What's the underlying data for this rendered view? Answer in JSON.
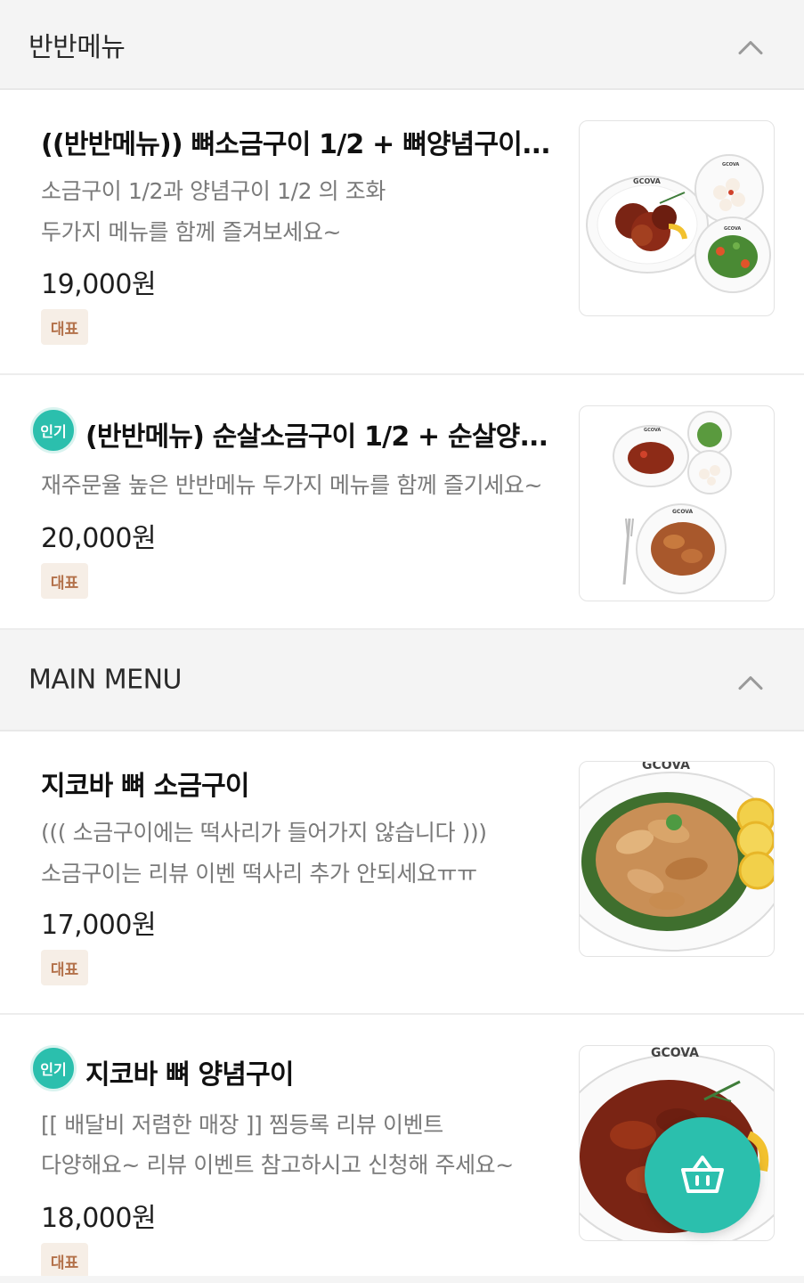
{
  "sections": [
    {
      "title": "반반메뉴",
      "collapse_icon": "chevron-up-icon",
      "items": [
        {
          "name": "((반반메뉴)) 뼈소금구이 1/2 + 뼈양념구이...",
          "popular_badge": "",
          "desc_lines": [
            "소금구이 1/2과 양념구이 1/2 의 조화",
            "두가지 메뉴를 함께 즐겨보세요~"
          ],
          "price": "19,000원",
          "tag": "대표",
          "image_brand": "GCOVA"
        },
        {
          "name": "(반반메뉴) 순살소금구이 1/2 + 순살양...",
          "popular_badge": "인기",
          "desc_lines": [
            "재주문율 높은 반반메뉴 두가지 메뉴를 함께 즐기세요~"
          ],
          "price": "20,000원",
          "tag": "대표",
          "image_brand": "GCOVA"
        }
      ]
    },
    {
      "title": "MAIN MENU",
      "collapse_icon": "chevron-up-icon",
      "items": [
        {
          "name": "지코바 뼈 소금구이",
          "popular_badge": "",
          "desc_lines": [
            "((( 소금구이에는 떡사리가 들어가지 않습니다 )))",
            "소금구이는 리뷰 이벤 떡사리 추가 안되세요ㅠㅠ"
          ],
          "price": "17,000원",
          "tag": "대표",
          "image_brand": "GCOVA"
        },
        {
          "name": "지코바 뼈 양념구이",
          "popular_badge": "인기",
          "desc_lines": [
            "[[ 배달비 저렴한 매장 ]]  찜등록  리뷰 이벤트",
            "다양해요~ 리뷰 이벤트 참고하시고 신청해 주세요~"
          ],
          "price": "18,000원",
          "tag": "대표",
          "image_brand": "GCOVA"
        }
      ]
    }
  ],
  "cart_button": {
    "icon": "shopping-basket-icon"
  },
  "colors": {
    "accent": "#2bbfad",
    "tag_bg": "#f6eee6",
    "tag_text": "#b3714a",
    "header_bg": "#f4f4f4"
  }
}
